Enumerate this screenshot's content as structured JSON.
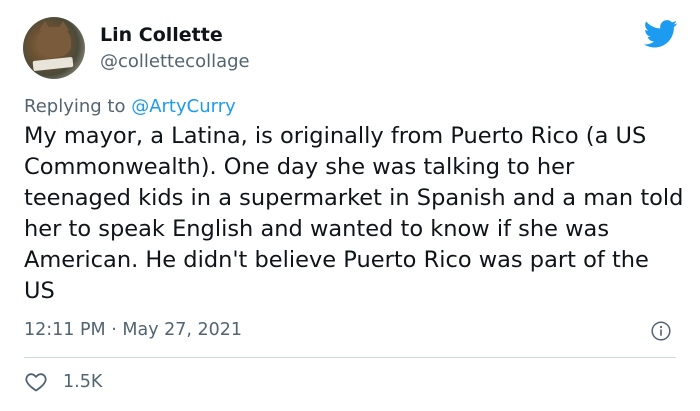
{
  "author": {
    "name": "Lin Collette",
    "handle": "@collettecollage"
  },
  "reply": {
    "prefix": "Replying to",
    "mention": "@ArtyCurry"
  },
  "tweet": {
    "text": "My mayor, a Latina, is originally from Puerto Rico (a US Commonwealth). One day she was talking to her teenaged kids in a supermarket in Spanish and a man told her to speak English and wanted to know if she was American. He didn't believe Puerto Rico was part of the US"
  },
  "meta": {
    "time": "12:11 PM",
    "separator": "·",
    "date": "May 27, 2021"
  },
  "stats": {
    "likes": "1.5K"
  },
  "colors": {
    "brand": "#1d9bf0",
    "secondary_text": "#536471",
    "divider": "#cfd9de"
  },
  "icons": {
    "logo": "twitter-bird-icon",
    "info": "info-icon",
    "like": "heart-icon"
  }
}
